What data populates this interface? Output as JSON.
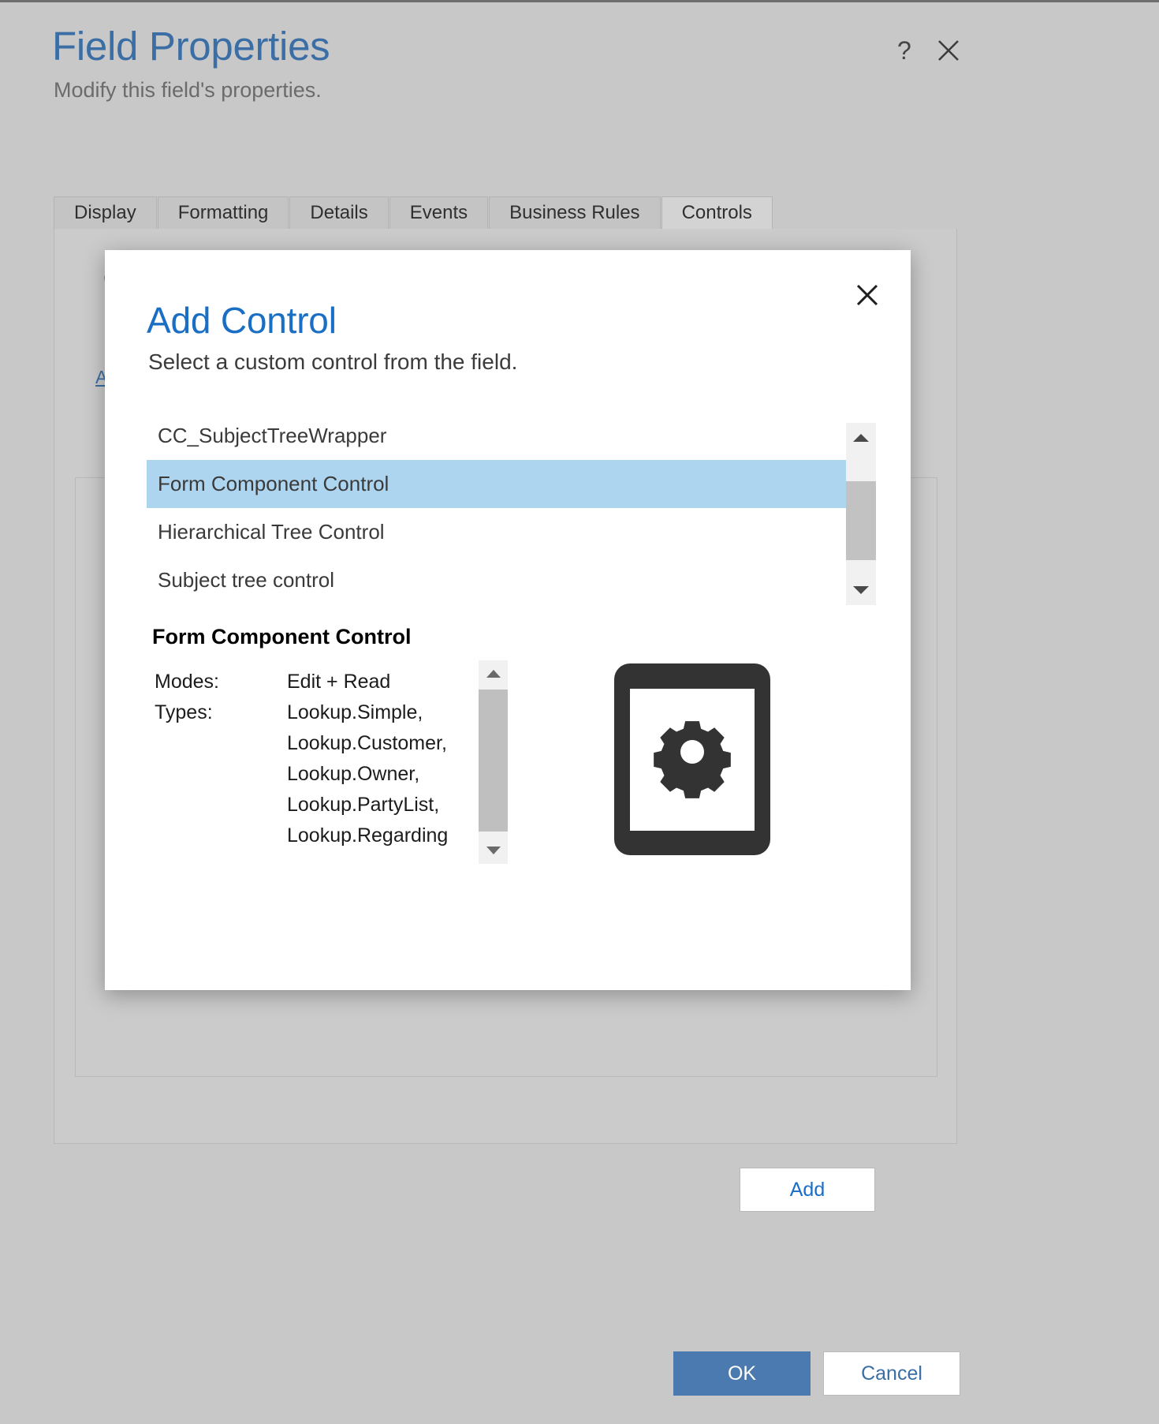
{
  "window": {
    "title": "Field Properties",
    "subtitle": "Modify this field's properties.",
    "help_icon": "question-mark-icon",
    "close_icon": "close-icon"
  },
  "tabs": [
    {
      "label": "Display",
      "active": false
    },
    {
      "label": "Formatting",
      "active": false
    },
    {
      "label": "Details",
      "active": false
    },
    {
      "label": "Events",
      "active": false
    },
    {
      "label": "Business Rules",
      "active": false
    },
    {
      "label": "Controls",
      "active": true
    }
  ],
  "panel": {
    "heading": "C",
    "subtext": "",
    "link": "A"
  },
  "dialog": {
    "title": "Add Control",
    "subtitle": "Select a custom control from the field.",
    "close_icon": "close-icon",
    "controls": [
      {
        "label": "CC_SubjectTreeWrapper",
        "selected": false
      },
      {
        "label": "Form Component Control",
        "selected": true
      },
      {
        "label": "Hierarchical Tree Control",
        "selected": false
      },
      {
        "label": "Subject tree control",
        "selected": false
      }
    ],
    "list_scrollbar": {
      "up_icon": "scroll-up-arrow-icon",
      "down_icon": "scroll-down-arrow-icon"
    },
    "detail": {
      "title": "Form Component Control",
      "modes_label": "Modes:",
      "modes_value": "Edit + Read",
      "types_label": "Types:",
      "types_values": [
        "Lookup.Simple,",
        "Lookup.Customer,",
        "Lookup.Owner,",
        "Lookup.PartyList,",
        "Lookup.Regarding"
      ],
      "scrollbar": {
        "up_icon": "scroll-up-arrow-icon",
        "down_icon": "scroll-down-arrow-icon"
      },
      "preview_icon": "tablet-gear-icon"
    },
    "add_button": "Add"
  },
  "footer": {
    "ok_label": "OK",
    "cancel_label": "Cancel"
  },
  "colors": {
    "accent_blue": "#1a6ec4",
    "title_blue": "#3a6ea5",
    "selection_blue": "#aed5ef",
    "window_bg": "#c8c8c8",
    "dialog_bg": "#ffffff",
    "ok_button_bg": "#4a7ab0"
  }
}
